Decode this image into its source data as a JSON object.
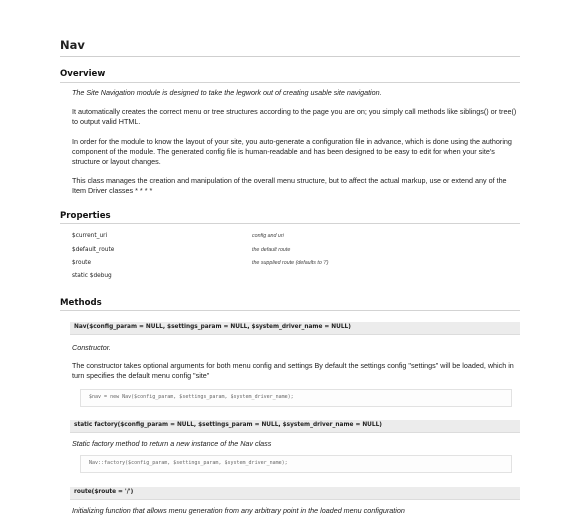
{
  "page": {
    "title": "Nav"
  },
  "overview": {
    "heading": "Overview",
    "intro": "The Site Navigation module is designed to take the legwork out of creating usable site navigation.",
    "p1": "It automatically creates the correct menu or tree structures according to the page you are on; you simply call methods like siblings() or tree() to output valid HTML.",
    "p2": "In order for the module to know the layout of your site, you auto-generate a configuration file in advance, which is done using the authoring component of the module. The generated config file is human-readable and has been designed to be easy to edit for when your site's structure or layout changes.",
    "p3": "This class manages the creation and manipulation of the overall menu structure, but to affect the actual markup, use or extend any of the Item Driver classes * * * *"
  },
  "properties": {
    "heading": "Properties",
    "items": [
      {
        "name": "$current_uri",
        "desc": "config and uri"
      },
      {
        "name": "$default_route",
        "desc": "the default route"
      },
      {
        "name": "$route",
        "desc": "the supplied route (defaults to '/')"
      },
      {
        "name": "static $debug",
        "desc": ""
      }
    ]
  },
  "methods": {
    "heading": "Methods",
    "items": [
      {
        "signature": "Nav($config_param = NULL, $settings_param = NULL, $system_driver_name = NULL)",
        "summary": "Constructor.",
        "detail": "The constructor takes optional arguments for both menu config and settings By default the settings config \"settings\" will be loaded, which in turn specifies the default menu config \"site\"",
        "code": "$nav = new Nav($config_param, $settings_param, $system_driver_name);"
      },
      {
        "signature": "static factory($config_param = NULL, $settings_param = NULL, $system_driver_name = NULL)",
        "summary": "Static factory method to return a new instance of the Nav class",
        "code": "Nav::factory($config_param, $settings_param, $system_driver_name);"
      },
      {
        "signature": "route($route = '/')",
        "summary": "Initializing function that allows menu generation from any arbitrary point in the loaded menu configuration"
      }
    ]
  }
}
